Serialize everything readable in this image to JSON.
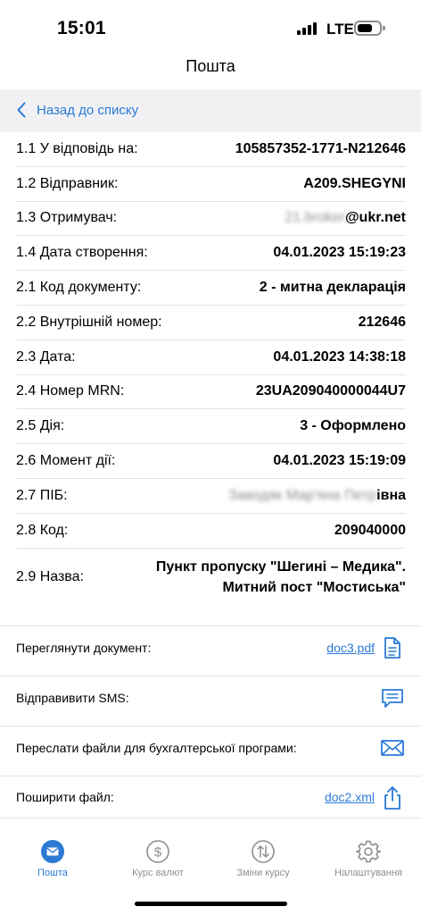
{
  "status_bar": {
    "time": "15:01",
    "network": "LTE"
  },
  "nav": {
    "title": "Пошта",
    "back_label": "Назад до списку"
  },
  "details": [
    {
      "label": "1.1 У відповідь на:",
      "value": "105857352-1771-N212646"
    },
    {
      "label": "1.2 Відправник:",
      "value": "A209.SHEGYNI"
    },
    {
      "label": "1.3 Отримувач:",
      "value_blurred": "21.broker",
      "value": "@ukr.net"
    },
    {
      "label": "1.4 Дата створення:",
      "value": "04.01.2023 15:19:23"
    },
    {
      "label": "2.1 Код документу:",
      "value": "2 - митна декларація"
    },
    {
      "label": "2.2 Внутрішній номер:",
      "value": "212646"
    },
    {
      "label": "2.3 Дата:",
      "value": "04.01.2023 14:38:18"
    },
    {
      "label": "2.4 Номер MRN:",
      "value": "23UA209040000044U7"
    },
    {
      "label": "2.5 Дія:",
      "value": "3 - Оформлено"
    },
    {
      "label": "2.6 Момент дії:",
      "value": "04.01.2023 15:19:09"
    },
    {
      "label": "2.7 ПІБ:",
      "value_blurred": "Заводяк Мар'яна Петр",
      "value": "івна"
    },
    {
      "label": "2.8 Код:",
      "value": "209040000"
    },
    {
      "label": "2.9 Назва:",
      "value_line1": "Пункт пропуску \"Шегині – Медика\".",
      "value_line2": "Митний пост \"Мостиська\""
    }
  ],
  "actions": {
    "view_document": {
      "label": "Переглянути документ:",
      "link": "doc3.pdf",
      "icon": "document-icon"
    },
    "send_sms": {
      "label": "Відправивити SMS:",
      "icon": "sms-icon"
    },
    "forward_files": {
      "label": "Переслати файли для бухгалтерської програми:",
      "icon": "envelope-icon"
    },
    "share_file": {
      "label": "Поширити файл:",
      "link": "doc2.xml",
      "icon": "share-icon"
    }
  },
  "tabs": [
    {
      "label": "Пошта",
      "icon": "mail-icon",
      "active": true
    },
    {
      "label": "Курс валют",
      "icon": "dollar-icon",
      "active": false
    },
    {
      "label": "Зміни курсу",
      "icon": "arrows-updown-icon",
      "active": false
    },
    {
      "label": "Налаштування",
      "icon": "gear-icon",
      "active": false
    }
  ],
  "colors": {
    "accent": "#2a7ad6",
    "inactive": "#8e8e93",
    "back_bar": "#f1f1f4",
    "divider": "#e4e4e6"
  }
}
